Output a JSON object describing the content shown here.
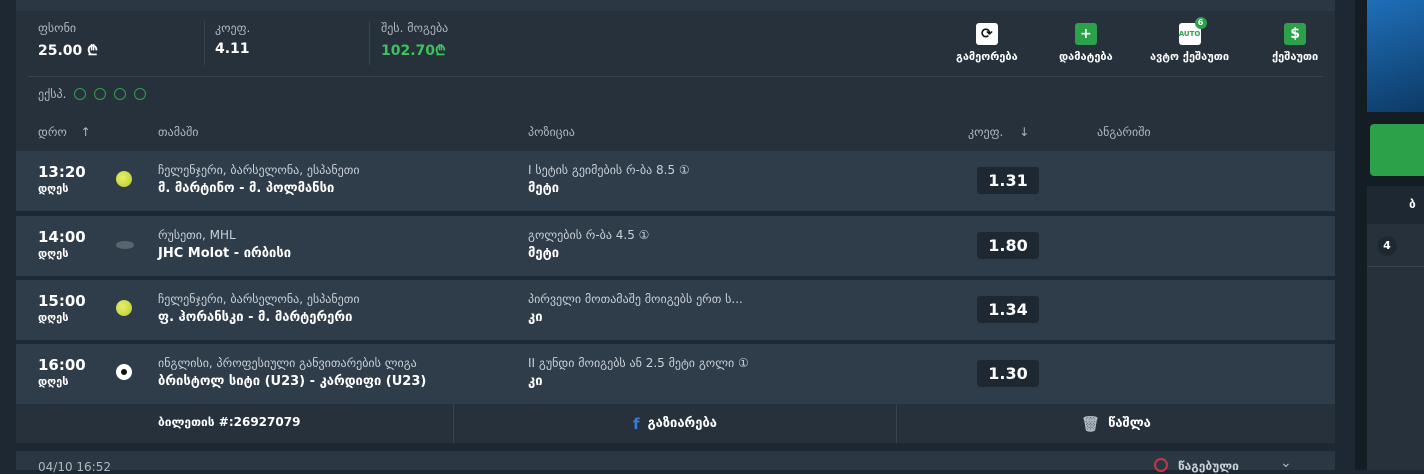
{
  "summary": {
    "stake_label": "ფსონი",
    "stake_value": "25.00 ₾",
    "odds_label": "კოეფ.",
    "odds_value": "4.11",
    "win_label": "შეს. მოგება",
    "win_value": "102.70₾",
    "actions": [
      {
        "label": "გამეორება",
        "icon": "refresh-icon"
      },
      {
        "label": "დამატება",
        "icon": "plus-icon"
      },
      {
        "label": "ავტო ქეშაუთი",
        "icon": "auto-icon",
        "icon_text": "AUTO",
        "badge": "6"
      },
      {
        "label": "ქეშაუთი",
        "icon": "dollar-icon",
        "icon_text": "$"
      }
    ]
  },
  "express_label": "ექსპ.",
  "columns": {
    "time": "დრო",
    "game": "თამაში",
    "position": "პოზიცია",
    "odds": "კოეფ.",
    "report": "ანგარიში"
  },
  "rows": [
    {
      "time": "13:20",
      "day": "დღეს",
      "sport": "tennis",
      "league": "ჩელენჯერი, ბარსელონა, ესპანეთი",
      "match": "მ. მარტინო - მ. პოლმანსი",
      "market": "I სეტის გეიმების რ-ბა 8.5 ①",
      "pick": "მეტი",
      "odd": "1.31"
    },
    {
      "time": "14:00",
      "day": "დღეს",
      "sport": "hockey",
      "league": "რუსეთი, MHL",
      "match": "JHC Molot - ირბისი",
      "market": "გოლების რ-ბა 4.5 ①",
      "pick": "მეტი",
      "odd": "1.80"
    },
    {
      "time": "15:00",
      "day": "დღეს",
      "sport": "tennis",
      "league": "ჩელენჯერი, ბარსელონა, ესპანეთი",
      "match": "ფ. ჰორანსკი - მ. მარტერერი",
      "market": "პირველი მოთამაშე მოიგებს ერთ ს...",
      "pick": "კი",
      "odd": "1.34"
    },
    {
      "time": "16:00",
      "day": "დღეს",
      "sport": "football",
      "league": "ინგლისი, პროფესიული განვითარების ლიგა",
      "match": "ბრისტოლ სიტი (U23) - კარდიფი (U23)",
      "market": "II გუნდი მოიგებს ან 2.5 მეტი გოლი ①",
      "pick": "კი",
      "odd": "1.30"
    }
  ],
  "footer": {
    "ticket": "ბილეთის #:26927079",
    "share": "გაზიარება",
    "delete": "წაშლა"
  },
  "next": {
    "date": "04/10 16:52",
    "status": "წაგებული"
  },
  "right_panel": {
    "header": "ბ",
    "count": "4"
  }
}
